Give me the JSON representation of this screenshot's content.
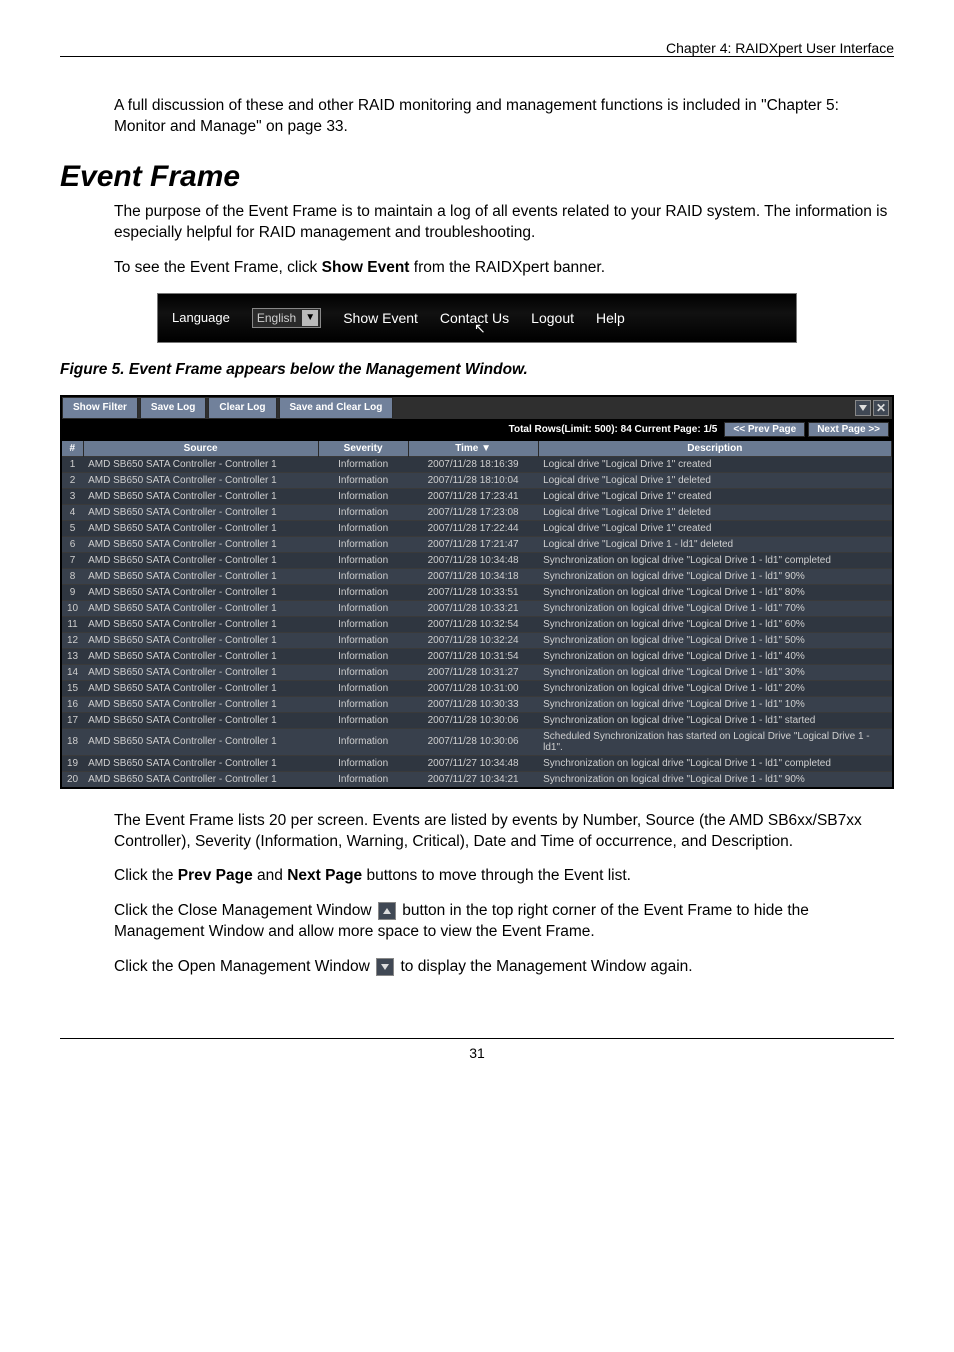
{
  "header": {
    "chapter": "Chapter 4: RAIDXpert User Interface"
  },
  "intro": "A full discussion of these and other RAID monitoring and management functions is included in \"Chapter 5: Monitor and Manage\" on page 33.",
  "section_title": "Event Frame",
  "para1": "The purpose of the Event Frame is to maintain a log of all events related to your RAID system. The information is especially helpful for RAID management and troubleshooting.",
  "para2_a": "To see the Event Frame, click ",
  "para2_bold": "Show Event",
  "para2_b": " from the RAIDXpert banner.",
  "banner": {
    "language_label": "Language",
    "language_value": "English",
    "show_event": "Show Event",
    "contact_us": "Contact Us",
    "logout": "Logout",
    "help": "Help"
  },
  "figure_caption": "Figure 5.  Event Frame appears below the Management Window.",
  "event_frame": {
    "toolbar": {
      "show_filter": "Show Filter",
      "save_log": "Save Log",
      "clear_log": "Clear Log",
      "save_and_clear": "Save and Clear Log"
    },
    "pager": {
      "info": "Total Rows(Limit: 500): 84 Current Page: 1/5",
      "prev": "<< Prev Page",
      "next": "Next Page >>"
    },
    "columns": {
      "num": "#",
      "source": "Source",
      "severity": "Severity",
      "time": "Time ▼",
      "description": "Description"
    },
    "rows": [
      {
        "n": "1",
        "src": "AMD SB650 SATA Controller - Controller 1",
        "sev": "Information",
        "time": "2007/11/28 18:16:39",
        "desc": "Logical drive \"Logical Drive 1\" created"
      },
      {
        "n": "2",
        "src": "AMD SB650 SATA Controller - Controller 1",
        "sev": "Information",
        "time": "2007/11/28 18:10:04",
        "desc": "Logical drive \"Logical Drive 1\" deleted"
      },
      {
        "n": "3",
        "src": "AMD SB650 SATA Controller - Controller 1",
        "sev": "Information",
        "time": "2007/11/28 17:23:41",
        "desc": "Logical drive \"Logical Drive 1\" created"
      },
      {
        "n": "4",
        "src": "AMD SB650 SATA Controller - Controller 1",
        "sev": "Information",
        "time": "2007/11/28 17:23:08",
        "desc": "Logical drive \"Logical Drive 1\" deleted"
      },
      {
        "n": "5",
        "src": "AMD SB650 SATA Controller - Controller 1",
        "sev": "Information",
        "time": "2007/11/28 17:22:44",
        "desc": "Logical drive \"Logical Drive 1\" created"
      },
      {
        "n": "6",
        "src": "AMD SB650 SATA Controller - Controller 1",
        "sev": "Information",
        "time": "2007/11/28 17:21:47",
        "desc": "Logical drive \"Logical Drive 1 - ld1\" deleted"
      },
      {
        "n": "7",
        "src": "AMD SB650 SATA Controller - Controller 1",
        "sev": "Information",
        "time": "2007/11/28 10:34:48",
        "desc": "Synchronization on logical drive \"Logical Drive 1 - ld1\" completed"
      },
      {
        "n": "8",
        "src": "AMD SB650 SATA Controller - Controller 1",
        "sev": "Information",
        "time": "2007/11/28 10:34:18",
        "desc": "Synchronization on logical drive \"Logical Drive 1 - ld1\" 90%"
      },
      {
        "n": "9",
        "src": "AMD SB650 SATA Controller - Controller 1",
        "sev": "Information",
        "time": "2007/11/28 10:33:51",
        "desc": "Synchronization on logical drive \"Logical Drive 1 - ld1\" 80%"
      },
      {
        "n": "10",
        "src": "AMD SB650 SATA Controller - Controller 1",
        "sev": "Information",
        "time": "2007/11/28 10:33:21",
        "desc": "Synchronization on logical drive \"Logical Drive 1 - ld1\" 70%"
      },
      {
        "n": "11",
        "src": "AMD SB650 SATA Controller - Controller 1",
        "sev": "Information",
        "time": "2007/11/28 10:32:54",
        "desc": "Synchronization on logical drive \"Logical Drive 1 - ld1\" 60%"
      },
      {
        "n": "12",
        "src": "AMD SB650 SATA Controller - Controller 1",
        "sev": "Information",
        "time": "2007/11/28 10:32:24",
        "desc": "Synchronization on logical drive \"Logical Drive 1 - ld1\" 50%"
      },
      {
        "n": "13",
        "src": "AMD SB650 SATA Controller - Controller 1",
        "sev": "Information",
        "time": "2007/11/28 10:31:54",
        "desc": "Synchronization on logical drive \"Logical Drive 1 - ld1\" 40%"
      },
      {
        "n": "14",
        "src": "AMD SB650 SATA Controller - Controller 1",
        "sev": "Information",
        "time": "2007/11/28 10:31:27",
        "desc": "Synchronization on logical drive \"Logical Drive 1 - ld1\" 30%"
      },
      {
        "n": "15",
        "src": "AMD SB650 SATA Controller - Controller 1",
        "sev": "Information",
        "time": "2007/11/28 10:31:00",
        "desc": "Synchronization on logical drive \"Logical Drive 1 - ld1\" 20%"
      },
      {
        "n": "16",
        "src": "AMD SB650 SATA Controller - Controller 1",
        "sev": "Information",
        "time": "2007/11/28 10:30:33",
        "desc": "Synchronization on logical drive \"Logical Drive 1 - ld1\" 10%"
      },
      {
        "n": "17",
        "src": "AMD SB650 SATA Controller - Controller 1",
        "sev": "Information",
        "time": "2007/11/28 10:30:06",
        "desc": "Synchronization on logical drive \"Logical Drive 1 - ld1\" started"
      },
      {
        "n": "18",
        "src": "AMD SB650 SATA Controller - Controller 1",
        "sev": "Information",
        "time": "2007/11/28 10:30:06",
        "desc": "Scheduled Synchronization has started on Logical Drive \"Logical Drive 1 - ld1\"."
      },
      {
        "n": "19",
        "src": "AMD SB650 SATA Controller - Controller 1",
        "sev": "Information",
        "time": "2007/11/27 10:34:48",
        "desc": "Synchronization on logical drive \"Logical Drive 1 - ld1\" completed"
      },
      {
        "n": "20",
        "src": "AMD SB650 SATA Controller - Controller 1",
        "sev": "Information",
        "time": "2007/11/27 10:34:21",
        "desc": "Synchronization on logical drive \"Logical Drive 1 - ld1\" 90%"
      }
    ]
  },
  "para3": "The Event Frame lists 20 per screen. Events are listed by events by Number, Source (the AMD SB6xx/SB7xx Controller), Severity (Information, Warning, Critical), Date and Time of occurrence, and Description.",
  "para4_a": "Click the ",
  "para4_b1": "Prev Page",
  "para4_mid": " and ",
  "para4_b2": "Next Page",
  "para4_c": " buttons to move through the Event list.",
  "para5_a": "Click the Close Management Window ",
  "para5_b": " button in the top right corner of the Event Frame to hide the Management Window and allow more space to view the Event Frame.",
  "para6_a": "Click the Open Management Window ",
  "para6_b": " to display the Management Window again.",
  "footer": {
    "page_number": "31"
  }
}
